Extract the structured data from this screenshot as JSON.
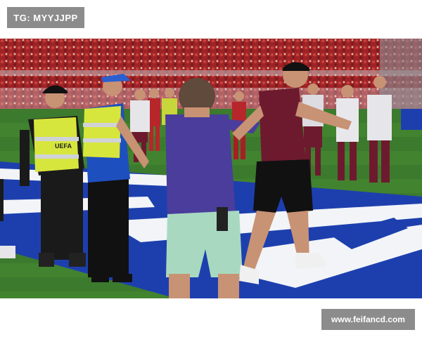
{
  "tag_label": "TG: MYYJJPP",
  "watermark_url": "www.feifancd.com",
  "vest_text": "UEFA",
  "colors": {
    "stand_red": "#b0282a",
    "pitch_green": "#3c7a2e",
    "pitch_blue": "#1d3fae",
    "line_white": "#f2f4f7",
    "hiviz": "#d7e63c",
    "maroon_shirt": "#6e1a2e",
    "purple_shirt": "#4a3d9c"
  }
}
